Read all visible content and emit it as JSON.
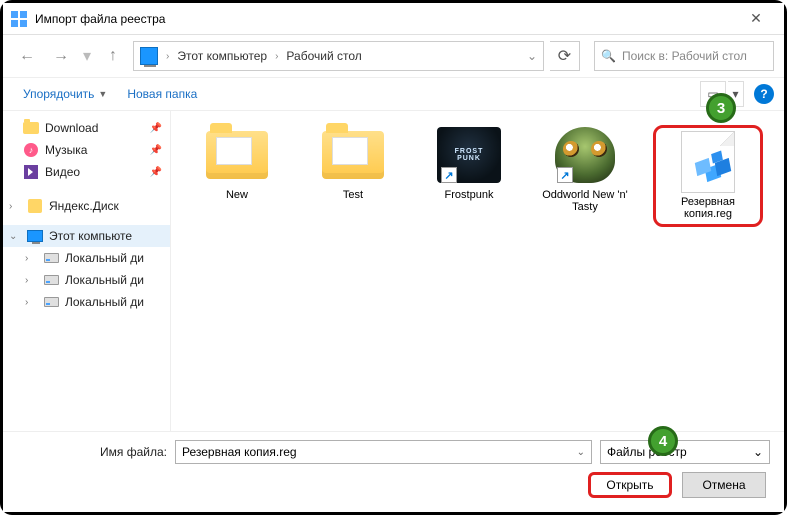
{
  "title": "Импорт файла реестра",
  "breadcrumb": {
    "pc": "Этот компьютер",
    "folder": "Рабочий стол"
  },
  "search_placeholder": "Поиск в: Рабочий стол",
  "toolbar": {
    "organize": "Упорядочить",
    "newfolder": "Новая папка"
  },
  "sidebar": {
    "download": "Download",
    "music": "Музыка",
    "video": "Видео",
    "yandex": "Яндекс.Диск",
    "thispc": "Этот компьюте",
    "disk1": "Локальный ди",
    "disk2": "Локальный ди",
    "disk3": "Локальный ди"
  },
  "files": {
    "f1": "New",
    "f2": "Test",
    "f3": "Frostpunk",
    "f4": "Oddworld New 'n' Tasty",
    "f5": "Резервная копия.reg"
  },
  "footer": {
    "filename_label": "Имя файла:",
    "filename_value": "Резервная копия.reg",
    "filter": "Файлы реестр",
    "open": "Открыть",
    "cancel": "Отмена"
  },
  "badges": {
    "b3": "3",
    "b4": "4"
  }
}
